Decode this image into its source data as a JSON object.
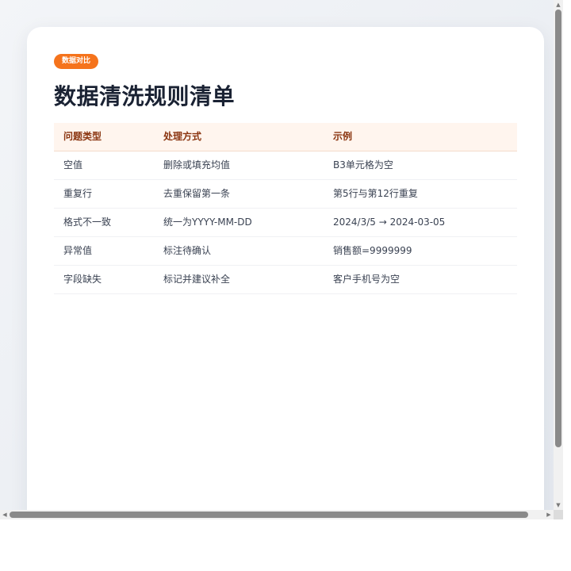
{
  "badge": "数据对比",
  "title": "数据清洗规则清单",
  "table": {
    "headers": [
      "问题类型",
      "处理方式",
      "示例"
    ],
    "rows": [
      [
        "空值",
        "删除或填充均值",
        "B3单元格为空"
      ],
      [
        "重复行",
        "去重保留第一条",
        "第5行与第12行重复"
      ],
      [
        "格式不一致",
        "统一为YYYY-MM-DD",
        "2024/3/5 → 2024-03-05"
      ],
      [
        "异常值",
        "标注待确认",
        "销售额=9999999"
      ],
      [
        "字段缺失",
        "标记并建议补全",
        "客户手机号为空"
      ]
    ]
  },
  "colors": {
    "accent": "#f5731c",
    "title": "#1a2233",
    "header_text": "#8a3510",
    "header_bg": "#fff5ee"
  },
  "scrollbars": {
    "up_icon": "triangle-up-icon",
    "down_icon": "triangle-down-icon",
    "left_icon": "triangle-left-icon",
    "right_icon": "triangle-right-icon"
  }
}
